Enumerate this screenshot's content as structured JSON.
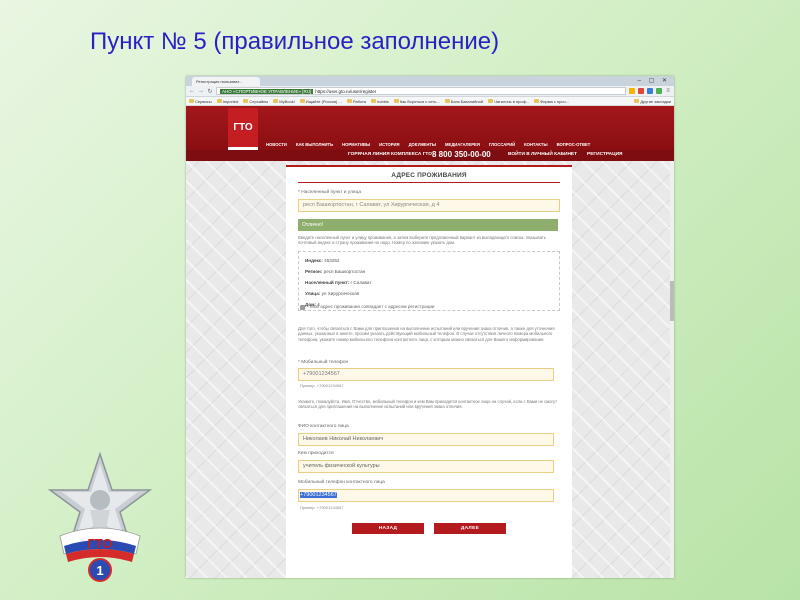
{
  "slide": {
    "title": "Пункт  № 5  (правильное заполнение)"
  },
  "browser": {
    "tab_title": "Регистрация пользоват...",
    "url_cert": "АНО «СПОРТИВНОЕ УПРАВЛЕНИЕ» [RU]",
    "url": "https://user.gto.ru/user/register",
    "bookmarks": [
      "Сервисы",
      "Imported",
      "Серсайны",
      "MyBook!",
      "Ищайте (Россия) ...",
      "Работа",
      "hobbis",
      "Как бороться с сеть...",
      "Банк Бакалийной",
      "Чатилочь в проф...",
      "Фирма с проч..."
    ],
    "bookmarks_other": "Другие закладки"
  },
  "site": {
    "logo": "ГТО",
    "nav": [
      "НОВОСТИ",
      "КАК ВЫПОЛНИТЬ",
      "НОРМАТИВЫ",
      "ИСТОРИЯ",
      "ДОКУМЕНТЫ",
      "МЕДИАГАЛЕРЕЯ",
      "ГЛОССАРИЙ",
      "КОНТАКТЫ",
      "ВОПРОС-ОТВЕТ"
    ],
    "hotline_label": "ГОРЯЧАЯ ЛИНИЯ КОМПЛЕКСА ГТО",
    "hotline_number": "8 800 350-00-00",
    "login": "ВОЙТИ В ЛИЧНЫЙ КАБИНЕТ",
    "register": "РЕГИСТРАЦИЯ"
  },
  "form": {
    "section_title": "АДРЕС ПРОЖИВАНИЯ",
    "locality_label": "* Населенный пункт и улица",
    "locality_value": "респ Башкортостан, г Салават, ул Хирургическая, д 4",
    "ok_message": "Отлично!",
    "hint_address": "Введите населенный пункт и улицу проживания, а затем выберите предложенный вариант из выпадающего списка. Указывать почтовый индекс и страну проживания не надо. Номер по желанию указать дом.",
    "address": {
      "index_label": "Индекс:",
      "index_value": "453252",
      "region_label": "Регион:",
      "region_value": "респ Башкортостан",
      "locality_label": "Населенный пункт:",
      "locality_value": "г Салават",
      "street_label": "Улица:",
      "street_value": "ул Хирургическая",
      "house_label": "Дом:",
      "house_value": "4"
    },
    "same_address_label": "Мой адрес проживания совпадает с адресом регистрации",
    "hint_phone": "Для того, чтобы связаться с Вами для приглашения на выполнение испытаний или вручения знака отличия, а также для уточнения данных, указанных в анкете, просим указать действующий мобильный телефон. В случае отсутствия личного номера мобильного телефона, укажите номер мобильного телефона контактного лица, с которым можно связаться для Вашего информирования.",
    "phone_label": "* Мобильный телефон",
    "phone_value": "+79001234567",
    "phone_sample": "Пример: +79001234567",
    "hint_contact": "Укажите, пожалуйста, Имя, Отчество, мобильный телефон и кем Вам приходится контактное лицо на случай, если с Вами не смогут связаться для приглашения на выполнение испытаний или вручения знака отличия.",
    "contact_name_label": "ФИО контактного лица",
    "contact_name_value": "Николаев Николай Николаевич",
    "relation_label": "Кем приходится",
    "relation_value": "учитель физической культуры",
    "contact_phone_label": "Мобильный телефон контактного лица",
    "contact_phone_value": "+79001234567",
    "contact_phone_sample": "Пример: +79001234567",
    "back_button": "НАЗАД",
    "next_button": "ДАЛЕЕ"
  },
  "badge": {
    "text": "ГТО",
    "number": "1"
  },
  "colors": {
    "title": "#2a1fc4",
    "brand_red": "#b31b1f",
    "ok_green": "#8eae6e",
    "input_bg": "#fdf8e8"
  }
}
